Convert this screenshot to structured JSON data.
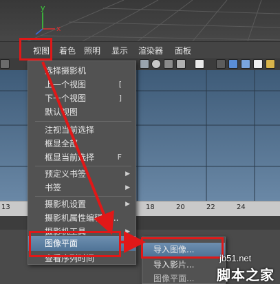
{
  "menubar": {
    "items": [
      {
        "label": "视图"
      },
      {
        "label": "着色"
      },
      {
        "label": "照明"
      },
      {
        "label": "显示"
      },
      {
        "label": "渲染器"
      },
      {
        "label": "面板"
      }
    ]
  },
  "axis": {
    "x": "x",
    "y": "y"
  },
  "view_menu": {
    "items": [
      {
        "label": "选择摄影机",
        "shortcut": "",
        "submenu": false
      },
      {
        "label": "上一个视图",
        "shortcut": "[",
        "submenu": false
      },
      {
        "label": "下一个视图",
        "shortcut": "]",
        "submenu": false
      },
      {
        "label": "默认视图",
        "shortcut": "",
        "submenu": false
      },
      {
        "label": "注视当前选择",
        "shortcut": "",
        "submenu": false
      },
      {
        "label": "框显全部",
        "shortcut": "",
        "submenu": false
      },
      {
        "label": "框显当前选择",
        "shortcut": "F",
        "submenu": false
      },
      {
        "label": "预定义书签",
        "shortcut": "",
        "submenu": true
      },
      {
        "label": "书签",
        "shortcut": "",
        "submenu": true
      },
      {
        "label": "摄影机设置",
        "shortcut": "",
        "submenu": true
      },
      {
        "label": "摄影机属性编辑器...",
        "shortcut": "",
        "submenu": false
      },
      {
        "label": "摄影机工具",
        "shortcut": "",
        "submenu": true
      },
      {
        "label": "图像平面",
        "shortcut": "",
        "submenu": true,
        "highlighted": true
      },
      {
        "label": "查看序列时间",
        "shortcut": "",
        "submenu": false
      }
    ]
  },
  "image_plane_submenu": {
    "items": [
      {
        "label": "导入图像..."
      },
      {
        "label": "导入影片..."
      },
      {
        "label": "图像平面..."
      }
    ]
  },
  "timeslider": {
    "ticks": [
      "13",
      "18",
      "20",
      "22",
      "24"
    ]
  },
  "watermark": {
    "url": "jb51.net",
    "text": "脚本之家"
  },
  "colors": {
    "highlight": "#5b7fa3",
    "callout": "#e01818",
    "viewport_blue": "#4e6d8c"
  }
}
